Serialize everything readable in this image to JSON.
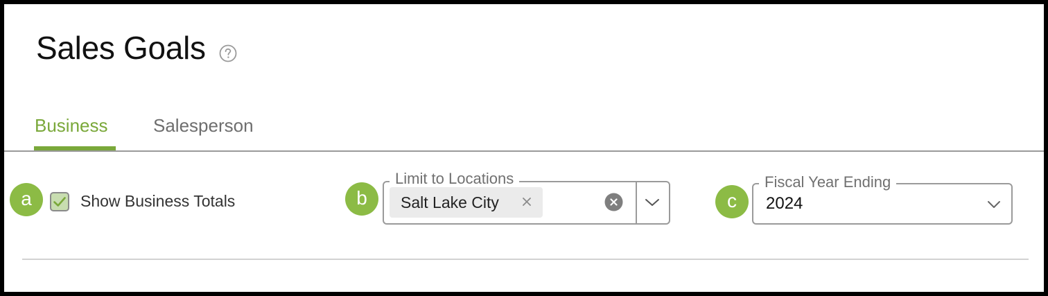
{
  "header": {
    "title": "Sales Goals",
    "help_icon": "question-circle-icon"
  },
  "tabs": [
    {
      "label": "Business",
      "active": true
    },
    {
      "label": "Salesperson",
      "active": false
    }
  ],
  "colors": {
    "accent": "#7aa83a",
    "badge": "#8cbb45",
    "border": "#9a9a9a",
    "chip_bg": "#ebebeb"
  },
  "annotations": [
    "a",
    "b",
    "c"
  ],
  "filters": {
    "show_business_totals": {
      "label": "Show Business Totals",
      "checked": true
    },
    "locations": {
      "legend": "Limit to Locations",
      "selected": [
        "Salt Lake City"
      ],
      "icons": [
        "close-icon",
        "clear-circle-icon",
        "chevron-down-icon"
      ]
    },
    "fiscal_year": {
      "legend": "Fiscal Year Ending",
      "value": "2024",
      "icon": "chevron-down-icon"
    }
  }
}
